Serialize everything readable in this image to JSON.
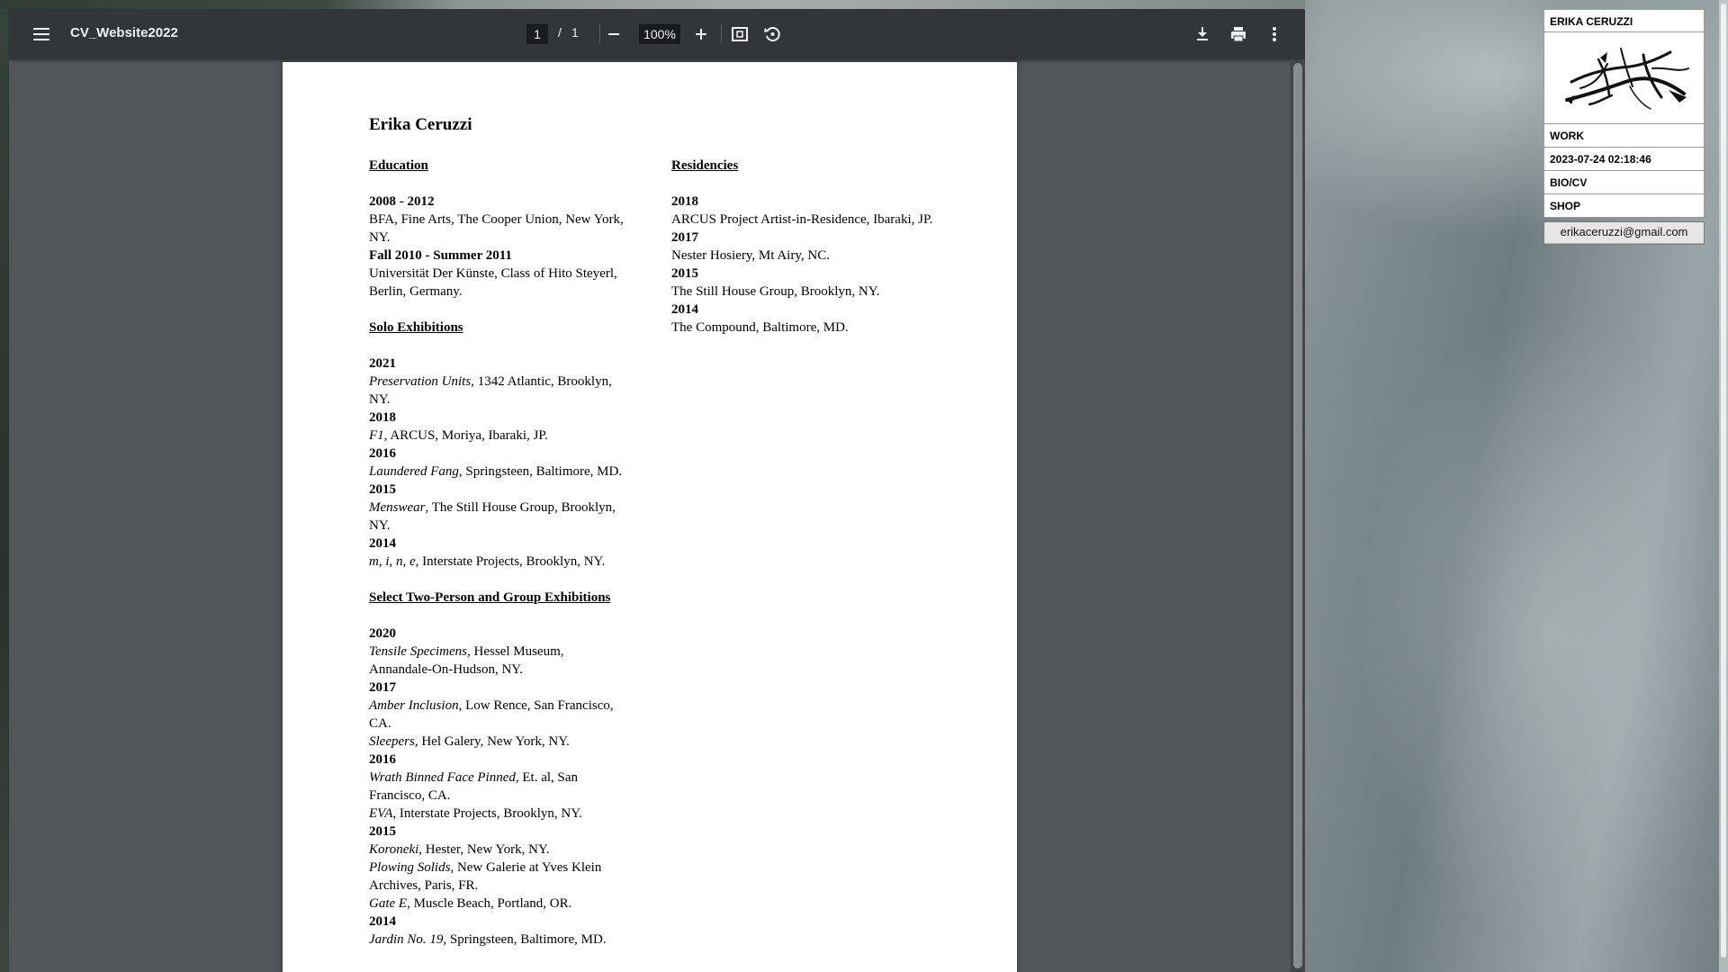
{
  "viewer": {
    "file_title": "CV_Website2022",
    "page_current": "1",
    "page_separator": "/",
    "page_total": "1",
    "zoom": "100%"
  },
  "document": {
    "name": "Erika Ceruzzi",
    "education": {
      "heading": "Education",
      "entries": [
        {
          "years": "2008 - 2012",
          "line1": "BFA, Fine Arts, The Cooper Union, New York,",
          "line2": "NY."
        },
        {
          "years": "Fall 2010 - Summer 2011",
          "line1": "Universität Der Künste, Class of Hito Steyerl,",
          "line2": "Berlin, Germany."
        }
      ]
    },
    "solo": {
      "heading": "Solo Exhibitions",
      "entries": [
        {
          "year": "2021",
          "title": "Preservation Units,",
          "rest": " 1342 Atlantic, Brooklyn,",
          "line2": "NY."
        },
        {
          "year": "2018",
          "title": "F1,",
          "rest": " ARCUS, Moriya, Ibaraki, JP.",
          "line2": ""
        },
        {
          "year": "2016",
          "title": "Laundered Fang",
          "rest": ", Springsteen, Baltimore, MD.",
          "line2": ""
        },
        {
          "year": "2015",
          "title": "Menswear",
          "rest": ", The Still House Group, Brooklyn,",
          "line2": "NY."
        },
        {
          "year": "2014",
          "title": "m, i, n, e,",
          "rest": "  Interstate Projects, Brooklyn, NY.",
          "line2": ""
        }
      ]
    },
    "group": {
      "heading": "Select Two-Person and Group Exhibitions",
      "y2020": "2020",
      "e2020_title": "Tensile Specimens,",
      "e2020_rest": " Hessel Museum,",
      "e2020_line2": "Annandale-On-Hudson, NY.",
      "y2017": "2017",
      "e2017a_title": "Amber Inclusion",
      "e2017a_rest": ", Low Rence, San Francisco,",
      "e2017a_line2": "CA.",
      "e2017b_title": "Sleepers",
      "e2017b_rest": ", Hel Galery,  New York, NY.",
      "y2016": "2016",
      "e2016a_title": "Wrath Binned Face Pinned",
      "e2016a_rest": ", Et. al, San",
      "e2016a_line2": "Francisco, CA.",
      "e2016b_title": "EVA",
      "e2016b_rest": ", Interstate Projects, Brooklyn, NY.",
      "y2015": "2015",
      "e2015a_title": "Koroneki",
      "e2015a_rest": ", Hester, New York, NY.",
      "e2015b_title": "Plowing Solids",
      "e2015b_rest": ", New Galerie at Yves Klein",
      "e2015b_line2": "Archives, Paris, FR.",
      "e2015c_title": "Gate E",
      "e2015c_rest": ", Muscle Beach, Portland, OR.",
      "y2014": "2014",
      "e2014_title": "Jardin No. 19,",
      "e2014_rest": " Springsteen, Baltimore, MD."
    },
    "residencies": {
      "heading": "Residencies",
      "entries": [
        {
          "year": "2018",
          "text": "ARCUS Project Artist-in-Residence, Ibaraki, JP."
        },
        {
          "year": "2017",
          "text": "Nester Hosiery, Mt Airy,  NC."
        },
        {
          "year": "2015",
          "text": "The Still House Group, Brooklyn, NY."
        },
        {
          "year": "2014",
          "text": "The Compound, Baltimore, MD."
        }
      ]
    }
  },
  "site_nav": {
    "name": "ERIKA CERUZZI",
    "work": "WORK",
    "timestamp": "2023-07-24 02:18:46",
    "bio": "BIO/CV",
    "shop": "SHOP",
    "email": "erikaceruzzi@gmail.com"
  },
  "icons": {
    "menu": "menu-icon",
    "zoom_out": "minus-icon",
    "zoom_in": "plus-icon",
    "fit": "fit-page-icon",
    "rotate": "rotate-icon",
    "download": "download-icon",
    "print": "print-icon",
    "more": "more-vert-icon"
  }
}
